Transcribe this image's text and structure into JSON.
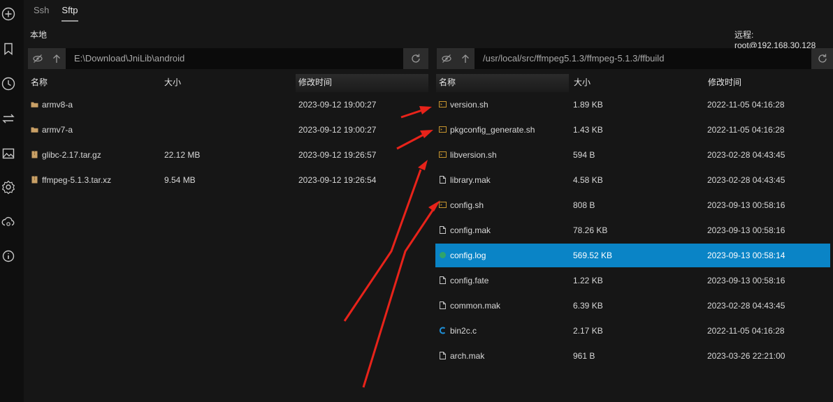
{
  "tabs": [
    "Ssh",
    "Sftp"
  ],
  "local": {
    "title": "本地",
    "path": "E:\\Download\\JniLib\\android",
    "headers": [
      "名称",
      "大小",
      "修改时间"
    ],
    "rows": [
      {
        "name": "armv8-a",
        "size": "",
        "time": "2023-09-12 19:00:27",
        "icon": "folder-icon"
      },
      {
        "name": "armv7-a",
        "size": "",
        "time": "2023-09-12 19:00:27",
        "icon": "folder-icon"
      },
      {
        "name": "glibc-2.17.tar.gz",
        "size": "22.12 MB",
        "time": "2023-09-12 19:26:57",
        "icon": "archive-icon"
      },
      {
        "name": "ffmpeg-5.1.3.tar.xz",
        "size": "9.54 MB",
        "time": "2023-09-12 19:26:54",
        "icon": "archive-icon"
      }
    ]
  },
  "remote": {
    "title": "远程: root@192.168.30.128",
    "path": "/usr/local/src/ffmpeg5.1.3/ffmpeg-5.1.3/ffbuild",
    "headers": [
      "名称",
      "大小",
      "修改时间"
    ],
    "rows": [
      {
        "name": "version.sh",
        "size": "1.89 KB",
        "time": "2022-11-05 04:16:28",
        "icon": "script-icon"
      },
      {
        "name": "pkgconfig_generate.sh",
        "size": "1.43 KB",
        "time": "2022-11-05 04:16:28",
        "icon": "script-icon"
      },
      {
        "name": "libversion.sh",
        "size": "594 B",
        "time": "2023-02-28 04:43:45",
        "icon": "script-icon"
      },
      {
        "name": "library.mak",
        "size": "4.58 KB",
        "time": "2023-02-28 04:43:45",
        "icon": "file-icon"
      },
      {
        "name": "config.sh",
        "size": "808 B",
        "time": "2023-09-13 00:58:16",
        "icon": "script-icon"
      },
      {
        "name": "config.mak",
        "size": "78.26 KB",
        "time": "2023-09-13 00:58:16",
        "icon": "file-icon"
      },
      {
        "name": "config.log",
        "size": "569.52 KB",
        "time": "2023-09-13 00:58:14",
        "icon": "log-icon"
      },
      {
        "name": "config.fate",
        "size": "1.22 KB",
        "time": "2023-09-13 00:58:16",
        "icon": "file-icon"
      },
      {
        "name": "common.mak",
        "size": "6.39 KB",
        "time": "2023-02-28 04:43:45",
        "icon": "file-icon"
      },
      {
        "name": "bin2c.c",
        "size": "2.17 KB",
        "time": "2022-11-05 04:16:28",
        "icon": "c-source-icon"
      },
      {
        "name": "arch.mak",
        "size": "961 B",
        "time": "2023-03-26 22:21:00",
        "icon": "file-icon"
      }
    ],
    "selected_row": "config.log"
  },
  "sidebar_icons": [
    "add-icon",
    "bookmark-icon",
    "history-icon",
    "transfer-icon",
    "image-icon",
    "settings-icon",
    "cloud-sync-icon",
    "info-icon"
  ],
  "colors": {
    "selection": "#0a84c6",
    "folder": "#c9a066",
    "script": "#c8962e",
    "c_source": "#1e90d8",
    "log": "#2fa46b",
    "annotation_arrow": "#e8231a"
  }
}
